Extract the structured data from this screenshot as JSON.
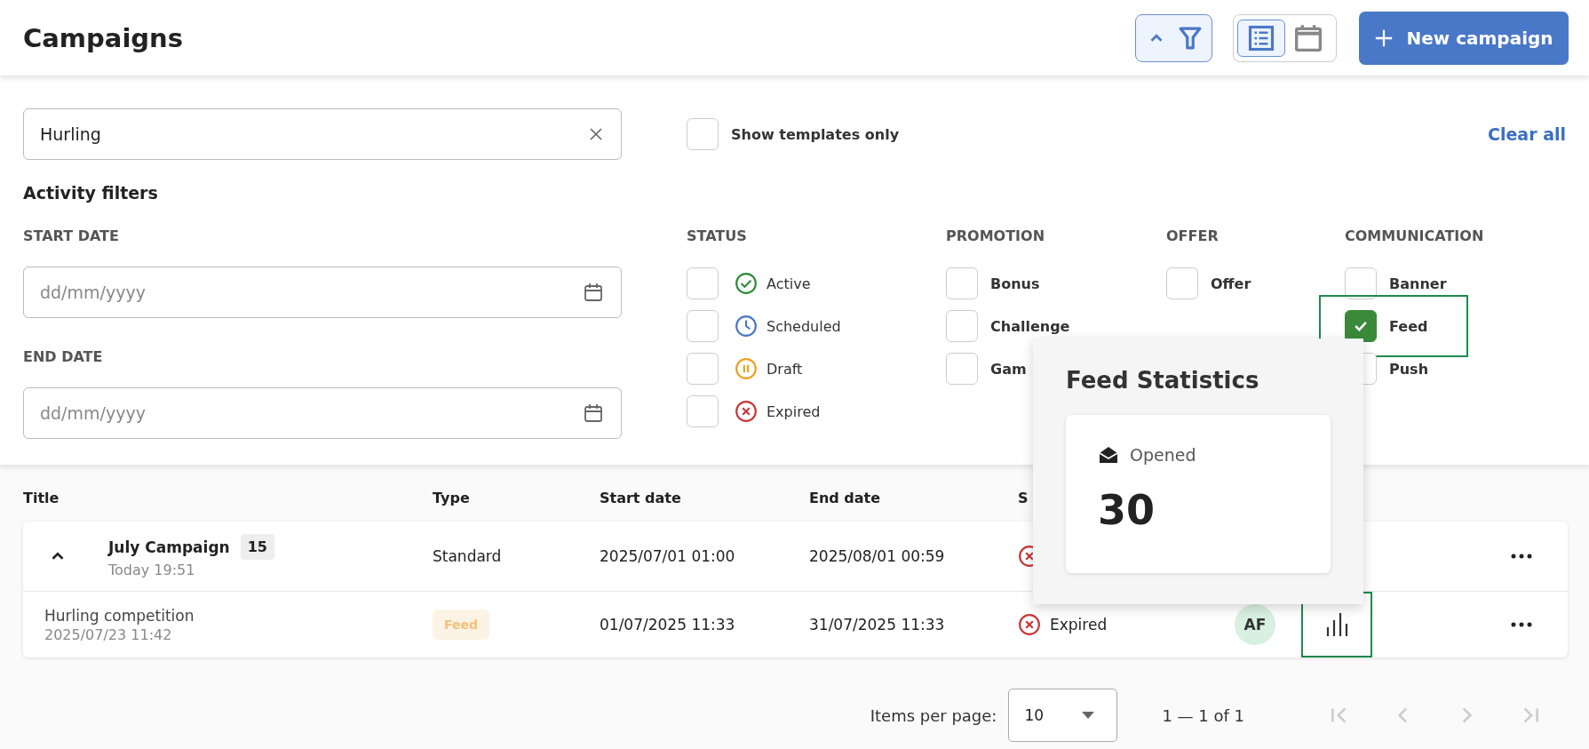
{
  "header": {
    "title": "Campaigns",
    "filter_toggle": {
      "expanded": true
    },
    "view_toggle": [
      {
        "kind": "list",
        "selected": true
      },
      {
        "kind": "calendar",
        "selected": false
      }
    ],
    "new_button": {
      "label": "New campaign"
    }
  },
  "filters": {
    "search": {
      "value": "Hurling"
    },
    "templates_only": {
      "label": "Show templates only",
      "checked": false
    },
    "clear_all": "Clear all",
    "activity_title": "Activity filters",
    "start_date": {
      "label": "START DATE",
      "placeholder": "dd/mm/yyyy"
    },
    "end_date": {
      "label": "END DATE",
      "placeholder": "dd/mm/yyyy"
    },
    "groups": [
      {
        "title": "STATUS",
        "options": [
          {
            "label": "Active",
            "kind": "active",
            "checked": false,
            "highlighted": false
          },
          {
            "label": "Scheduled",
            "kind": "scheduled",
            "checked": false,
            "highlighted": false
          },
          {
            "label": "Draft",
            "kind": "draft",
            "checked": false,
            "highlighted": false
          },
          {
            "label": "Expired",
            "kind": "expired",
            "checked": false,
            "highlighted": false
          }
        ]
      },
      {
        "title": "PROMOTION",
        "options": [
          {
            "label": "Bonus",
            "kind": "plain",
            "checked": false,
            "highlighted": false
          },
          {
            "label": "Challenge",
            "kind": "plain",
            "checked": false,
            "highlighted": false
          },
          {
            "label": "Gam",
            "kind": "plain",
            "checked": false,
            "highlighted": false
          }
        ]
      },
      {
        "title": "OFFER",
        "options": [
          {
            "label": "Offer",
            "kind": "plain",
            "checked": false,
            "highlighted": false
          }
        ]
      },
      {
        "title": "COMMUNICATION",
        "options": [
          {
            "label": "Banner",
            "kind": "plain",
            "checked": false,
            "highlighted": false
          },
          {
            "label": "Feed",
            "kind": "plain",
            "checked": true,
            "highlighted": true
          },
          {
            "label": "Push",
            "kind": "plain",
            "checked": false,
            "highlighted": false
          }
        ]
      }
    ]
  },
  "table": {
    "columns": [
      "Title",
      "Type",
      "Start date",
      "End date",
      "S"
    ],
    "rows": [
      {
        "expanded": true,
        "title": "July Campaign",
        "badge": "15",
        "subtitle": "Today 19:51",
        "type": {
          "kind": "text",
          "label": "Standard"
        },
        "start": "2025/07/01 01:00",
        "end": "2025/08/01 00:59",
        "status": {
          "kind": "expired"
        },
        "children": [
          {
            "title": "Hurling competition",
            "subtitle": "2025/07/23 11:42",
            "type": {
              "kind": "tag",
              "label": "Feed"
            },
            "start": "01/07/2025 11:33",
            "end": "31/07/2025 11:33",
            "status": {
              "kind": "expired",
              "label": "Expired"
            },
            "avatar": "AF",
            "stats_button": {
              "highlighted": true
            }
          }
        ]
      }
    ]
  },
  "popover": {
    "title": "Feed Statistics",
    "metric": {
      "label": "Opened",
      "value": "30"
    }
  },
  "pagination": {
    "label": "Items per page:",
    "page_size": "10",
    "range": "1 — 1 of 1",
    "nav": [
      {
        "kind": "first",
        "disabled": true
      },
      {
        "kind": "prev",
        "disabled": true
      },
      {
        "kind": "next",
        "disabled": true
      },
      {
        "kind": "last",
        "disabled": true
      }
    ]
  }
}
